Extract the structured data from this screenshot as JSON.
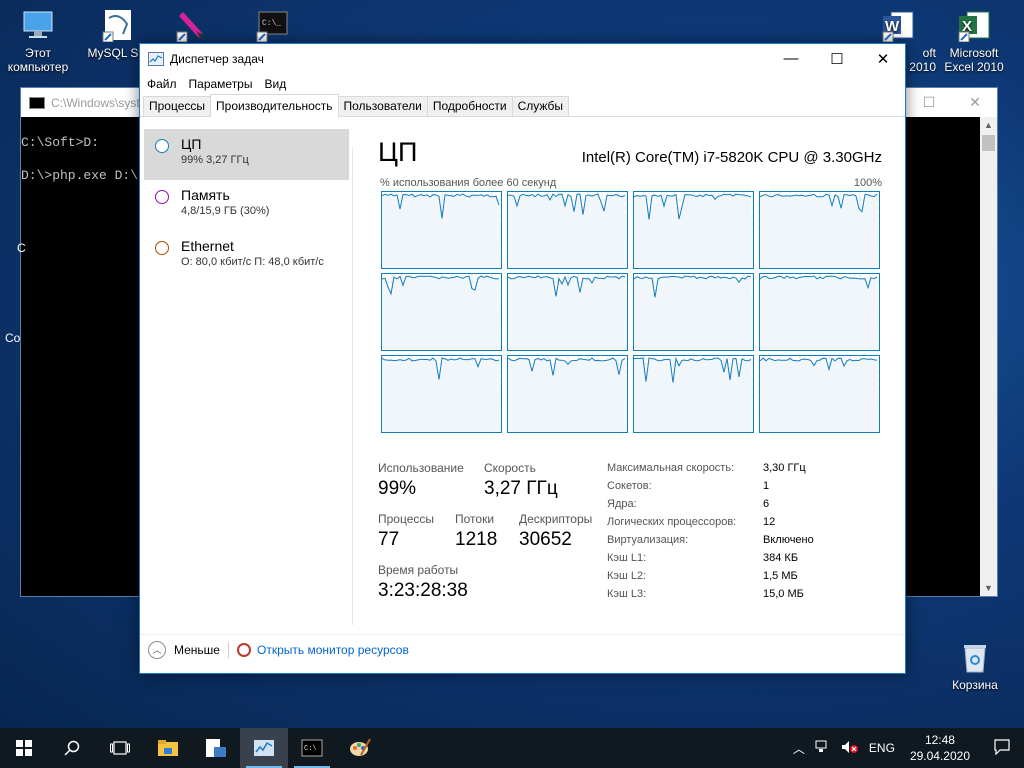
{
  "desktop": {
    "icons": [
      {
        "label": "Этот компьютер"
      },
      {
        "label": "MySQL Sto"
      },
      {
        "label": ""
      },
      {
        "label": ""
      },
      {
        "label": "oft\n2010"
      },
      {
        "label": "Microsoft Excel 2010"
      }
    ],
    "side_text_1": "C",
    "side_text_2": "Co",
    "recycle_bin": "Корзина"
  },
  "cmd": {
    "title": "C:\\Windows\\syst",
    "lines": [
      "C:\\Soft>D:",
      "D:\\>php.exe D:\\"
    ]
  },
  "taskmgr": {
    "title": "Диспетчер задач",
    "menu": [
      "Файл",
      "Параметры",
      "Вид"
    ],
    "tabs": [
      "Процессы",
      "Производительность",
      "Пользователи",
      "Подробности",
      "Службы"
    ],
    "active_tab": "Производительность",
    "resources": [
      {
        "name": "ЦП",
        "sub": "99% 3,27 ГГц",
        "color": "#117dbb"
      },
      {
        "name": "Память",
        "sub": "4,8/15,9 ГБ (30%)",
        "color": "#8b12ae"
      },
      {
        "name": "Ethernet",
        "sub": "О: 80,0 кбит/с П: 48,0 кбит/с",
        "color": "#a74f01"
      }
    ],
    "cpu": {
      "heading": "ЦП",
      "model": "Intel(R) Core(TM) i7-5820K CPU @ 3.30GHz",
      "util_label": "% использования более 60 секунд",
      "util_max": "100%",
      "core_count": 12,
      "stats": {
        "usage_label": "Использование",
        "usage": "99%",
        "speed_label": "Скорость",
        "speed": "3,27 ГГц",
        "processes_label": "Процессы",
        "processes": "77",
        "threads_label": "Потоки",
        "threads": "1218",
        "handles_label": "Дескрипторы",
        "handles": "30652",
        "uptime_label": "Время работы",
        "uptime": "3:23:28:38"
      },
      "details": [
        {
          "k": "Максимальная скорость:",
          "v": "3,30 ГГц"
        },
        {
          "k": "Сокетов:",
          "v": "1"
        },
        {
          "k": "Ядра:",
          "v": "6"
        },
        {
          "k": "Логических процессоров:",
          "v": "12"
        },
        {
          "k": "Виртуализация:",
          "v": "Включено"
        },
        {
          "k": "Кэш L1:",
          "v": "384 КБ"
        },
        {
          "k": "Кэш L2:",
          "v": "1,5 МБ"
        },
        {
          "k": "Кэш L3:",
          "v": "15,0 МБ"
        }
      ]
    },
    "footer": {
      "fewer": "Меньше",
      "resmon": "Открыть монитор ресурсов"
    }
  },
  "taskbar": {
    "lang": "ENG",
    "time": "12:48",
    "date": "29.04.2020"
  }
}
